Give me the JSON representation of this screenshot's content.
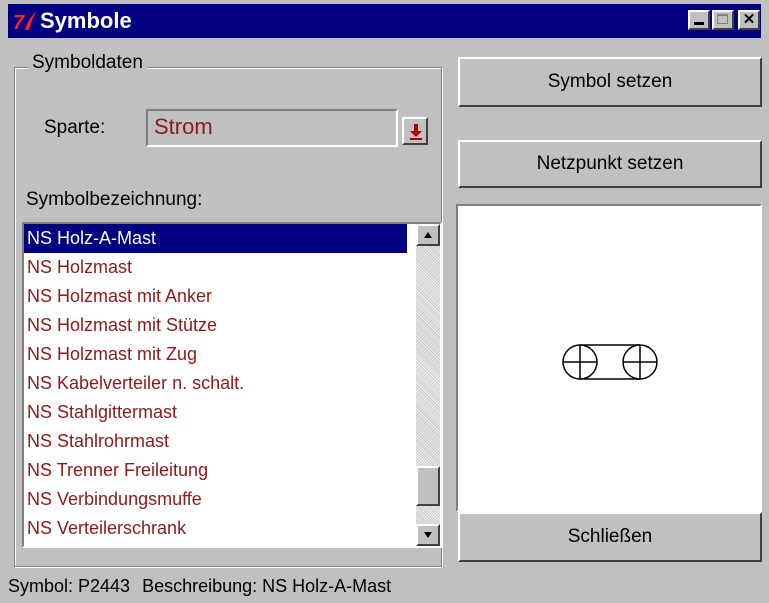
{
  "window": {
    "title": "Symbole",
    "icon": "tk-feather-icon",
    "controls": [
      "minimize-icon",
      "maximize-icon",
      "close-icon"
    ]
  },
  "group": {
    "label": "Symboldaten",
    "sparte_label": "Sparte:",
    "sparte_value": "Strom",
    "list_label": "Symbolbezeichnung:",
    "items": [
      {
        "label": "NS Holz-A-Mast",
        "selected": true
      },
      {
        "label": "NS Holzmast"
      },
      {
        "label": "NS Holzmast mit Anker"
      },
      {
        "label": "NS Holzmast mit Stütze"
      },
      {
        "label": "NS Holzmast mit Zug"
      },
      {
        "label": "NS Kabelverteiler n. schalt."
      },
      {
        "label": "NS Stahlgittermast"
      },
      {
        "label": "NS Stahlrohrmast"
      },
      {
        "label": "NS Trenner Freileitung"
      },
      {
        "label": "NS Verbindungsmuffe"
      },
      {
        "label": "NS Verteilerschrank"
      }
    ]
  },
  "buttons": {
    "set_symbol": "Symbol setzen",
    "set_netpoint": "Netzpunkt setzen",
    "close": "Schließen"
  },
  "status": {
    "symbol": "Symbol: P2443",
    "description": "Beschreibung: NS Holz-A-Mast"
  },
  "colors": {
    "titlebar": "#000080",
    "selection": "#000080",
    "list_text": "#8b1a1a",
    "window_bg": "#c0c0c0"
  }
}
